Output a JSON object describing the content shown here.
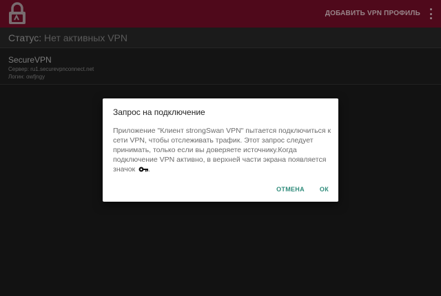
{
  "toolbar": {
    "add_profile_label": "ДОБАВИТЬ VPN ПРОФИЛЬ",
    "icon": "lock-icon",
    "menu_icon": "more-vert-icon",
    "background_color": "#7a0f2a"
  },
  "status": {
    "label": "Статус:",
    "value": "Нет активных VPN"
  },
  "profile": {
    "name": "SecureVPN",
    "server": "Сервер: ru1.securevpnconnect.net",
    "login": "Логин: owfjngy"
  },
  "dialog": {
    "title": "Запрос на подключение",
    "body": "Приложение \"Клиент strongSwan VPN\" пытается подключиться к сети VPN, чтобы отслеживать трафик. Этот запрос следует принимать, только если вы доверяете источнику.Когда подключение VPN активно, в верхней части экрана появляется значок",
    "body_end": ".",
    "body_icon": "key-icon",
    "cancel_label": "ОТМЕНА",
    "ok_label": "ОК",
    "button_color": "#2e8b7a"
  }
}
